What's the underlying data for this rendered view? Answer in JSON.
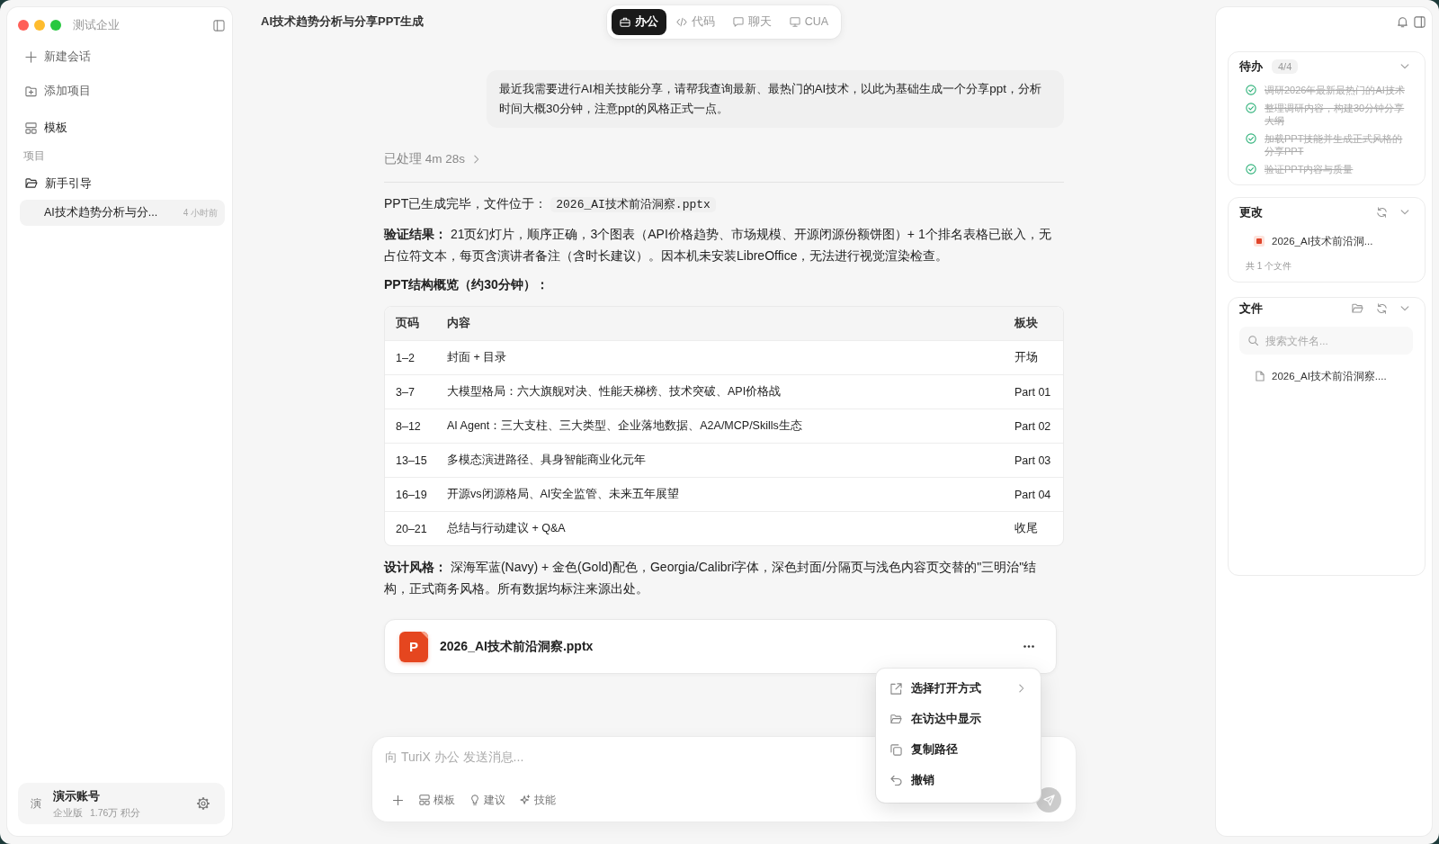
{
  "window": {
    "title": "AI技术趋势分析与分享PPT生成"
  },
  "sidebar": {
    "workspace": "测试企业",
    "new_chat": "新建会话",
    "add_project": "添加项目",
    "templates": "模板",
    "section_label": "项目",
    "projects": [
      {
        "name": "新手引导",
        "children": [
          {
            "title": "AI技术趋势分析与分...",
            "time": "4 小时前",
            "selected": true
          }
        ]
      }
    ],
    "account": {
      "avatar": "演",
      "name": "演示账号",
      "plan": "企业版",
      "points": "1.76万 积分"
    }
  },
  "modes": [
    {
      "label": "办公",
      "selected": true
    },
    {
      "label": "代码",
      "selected": false
    },
    {
      "label": "聊天",
      "selected": false
    },
    {
      "label": "CUA",
      "selected": false
    }
  ],
  "conversation": {
    "user_message": "最近我需要进行AI相关技能分享，请帮我查询最新、最热门的AI技术，以此为基础生成一个分享ppt，分析时间大概30分钟，注意ppt的风格正式一点。",
    "processed": "已处理 4m 28s",
    "file_notice": "PPT已生成完毕，文件位于：",
    "file_path": "2026_AI技术前沿洞察.pptx",
    "verification": "**验证结果：** 21页幻灯片，顺序正确，3个图表（API价格趋势、市场规模、开源闭源份额饼图）+ 1个排名表格已嵌入，无占位符文本，每页含演讲者备注（含时长建议）。因本机未安装LibreOffice，无法进行视觉渲染检查。",
    "outline_heading": "PPT结构概览（约30分钟）：",
    "table": {
      "columns": [
        "页码",
        "内容",
        "板块"
      ],
      "rows": [
        [
          "1–2",
          "封面 + 目录",
          "开场"
        ],
        [
          "3–7",
          "大模型格局：六大旗舰对决、性能天梯榜、技术突破、API价格战",
          "Part 01"
        ],
        [
          "8–12",
          "AI Agent：三大支柱、三大类型、企业落地数据、A2A/MCP/Skills生态",
          "Part 02"
        ],
        [
          "13–15",
          "多模态演进路径、具身智能商业化元年",
          "Part 03"
        ],
        [
          "16–19",
          "开源vs闭源格局、AI安全监管、未来五年展望",
          "Part 04"
        ],
        [
          "20–21",
          "总结与行动建议 + Q&A",
          "收尾"
        ]
      ]
    },
    "design": "**设计风格：** 深海军蓝(Navy) + 金色(Gold)配色，Georgia/Calibri字体，深色封面/分隔页与浅色内容页交替的\"三明治\"结构，正式商务风格。所有数据均标注来源出处。",
    "attachment": {
      "badge": "P",
      "name": "2026_AI技术前沿洞察.pptx"
    }
  },
  "context_menu": [
    {
      "label": "选择打开方式",
      "submenu": true
    },
    {
      "label": "在访达中显示",
      "submenu": false
    },
    {
      "label": "复制路径",
      "submenu": false
    },
    {
      "label": "撤销",
      "submenu": false
    }
  ],
  "composer": {
    "placeholder": "向 TuriX 办公 发送消息...",
    "tools": [
      "模板",
      "建议",
      "技能"
    ]
  },
  "right_panel": {
    "todo": {
      "title": "待办",
      "count": "4/4",
      "items": [
        {
          "text": "调研2026年最新最热门的AI技术",
          "checked": true
        },
        {
          "text": "整理调研内容，构建30分钟分享大纲",
          "checked": true
        },
        {
          "text": "加载PPT技能并生成正式风格的分享PPT",
          "checked": true
        },
        {
          "text": "验证PPT内容与质量",
          "checked": true
        }
      ]
    },
    "changes": {
      "title": "更改",
      "files": [
        {
          "name": "2026_AI技术前沿洞..."
        }
      ],
      "summary": "共 1 个文件"
    },
    "files": {
      "title": "文件",
      "search_placeholder": "搜索文件名...",
      "items": [
        {
          "name": "2026_AI技术前沿洞察...."
        }
      ]
    }
  }
}
